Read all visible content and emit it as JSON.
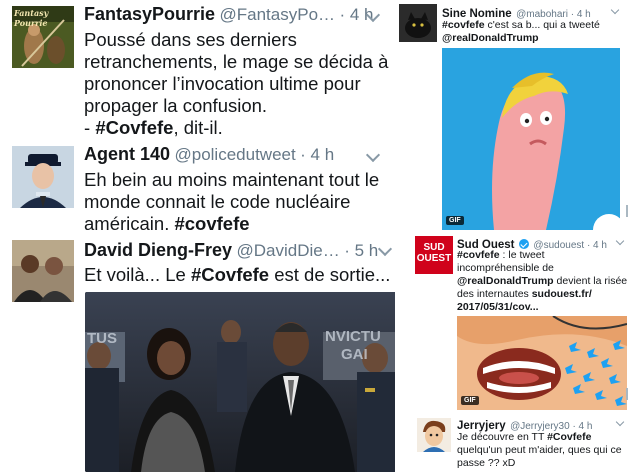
{
  "left_feed": [
    {
      "name": "FantasyPourrie",
      "handle": "@FantasyPo…",
      "time": "· 4 h",
      "avatar_text": "Fantasy Pourrie",
      "lines": [
        "Poussé dans ses derniers",
        "retranchements, le mage se décida à",
        "prononcer l’invocation ultime pour",
        "propager la confusion."
      ],
      "last_prefix": "- ",
      "hashtag": "#Covfefe",
      "last_suffix": ", dit-il."
    },
    {
      "name": "Agent 140",
      "handle": "@policedutweet",
      "time": "· 4 h",
      "lines": [
        "Eh bein au moins maintenant tout le",
        "monde connait le code nucléaire"
      ],
      "last_prefix": "américain. ",
      "hashtag": "#covfefe"
    },
    {
      "name": "David Dieng-Frey",
      "handle": "@DavidDie…",
      "time": "· 5 h",
      "text_prefix": "Et voilà... Le ",
      "hashtag": "#Covfefe",
      "text_suffix": " est de sortie...",
      "photo_backdrop": [
        "TUS",
        "NVICTU",
        "GAI"
      ]
    }
  ],
  "right_feed": [
    {
      "name": "Sine Nomine",
      "handle": "@mabohari · 4 h",
      "hashtag": "#covfefe",
      "text": " c'est sa b... qui a tweeté",
      "mention": "@realDonaldTrump",
      "badge": "GIF"
    },
    {
      "name": "Sud Ouest",
      "handle": "@sudouest · 4 h",
      "logo": [
        "SUD",
        "OUEST"
      ],
      "hashtag": "#covfefe",
      "line1_suffix": " : le tweet",
      "line2": "incompréhensible de",
      "mention": "@realDonaldTrump",
      "mention_suffix": " devient la risée",
      "line4_prefix": "des internautes ",
      "link1": "sudouest.fr/",
      "link2": "2017/05/31/cov...",
      "badge": "GIF"
    },
    {
      "name": "Jerryjery",
      "handle": "@Jerryjery30 · 4 h",
      "line1_prefix": "Je découvre en TT ",
      "hashtag": "#Covfefe",
      "line2": "quelqu'un peut m'aider, ques qui ce",
      "line3": "passe ?? xD"
    }
  ],
  "colors": {
    "text": "#14171a",
    "secondary": "#657786",
    "twitter_blue": "#1da1f2",
    "sud_ouest_red": "#d0021b",
    "gif_background": "#29a3e0"
  }
}
